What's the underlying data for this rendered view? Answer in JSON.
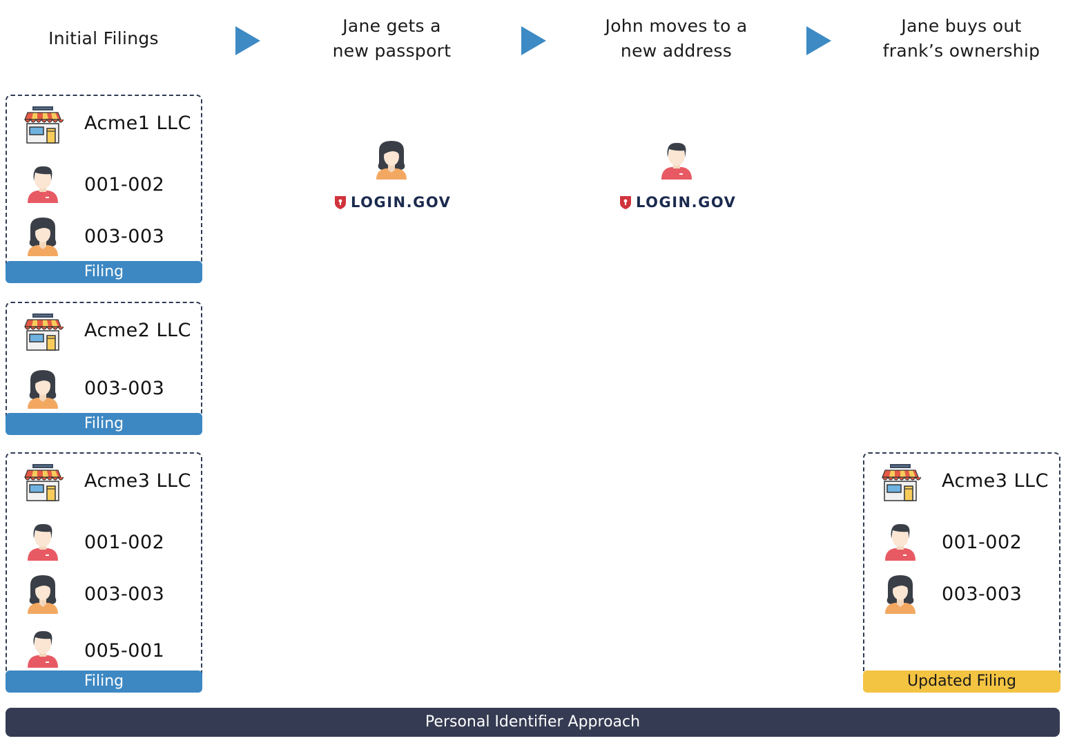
{
  "steps": [
    {
      "title_line1": "Initial Filings",
      "title_line2": ""
    },
    {
      "title_line1": "Jane gets a",
      "title_line2": "new passport"
    },
    {
      "title_line1": "John moves to a",
      "title_line2": "new address"
    },
    {
      "title_line1": "Jane buys out",
      "title_line2": "frank’s ownership"
    }
  ],
  "filings": [
    {
      "company": "Acme1 LLC",
      "owners": [
        {
          "id": "001-002",
          "icon": "male-person-icon"
        },
        {
          "id": "003-003",
          "icon": "female-person-icon"
        }
      ],
      "label": "Filing"
    },
    {
      "company": "Acme2 LLC",
      "owners": [
        {
          "id": "003-003",
          "icon": "female-person-icon"
        }
      ],
      "label": "Filing"
    },
    {
      "company": "Acme3 LLC",
      "owners": [
        {
          "id": "001-002",
          "icon": "male-person-icon"
        },
        {
          "id": "003-003",
          "icon": "female-person-icon"
        },
        {
          "id": "005-001",
          "icon": "male-person-icon"
        }
      ],
      "label": "Filing"
    }
  ],
  "updated_filing": {
    "company": "Acme3 LLC",
    "owners": [
      {
        "id": "001-002",
        "icon": "male-person-icon"
      },
      {
        "id": "003-003",
        "icon": "female-person-icon"
      }
    ],
    "label": "Updated Filing"
  },
  "login_events": [
    {
      "person": "female-person-icon",
      "brand": "LOGIN.GOV"
    },
    {
      "person": "male-person-icon",
      "brand": "LOGIN.GOV"
    }
  ],
  "footer": {
    "label": "Personal Identifier Approach"
  },
  "colors": {
    "arrow": "#3d8ac4",
    "filing_banner": "#3d88c3",
    "updated_banner": "#f3c342",
    "footer": "#343b52",
    "login_red": "#d0343c",
    "login_navy": "#1b2a4e"
  }
}
